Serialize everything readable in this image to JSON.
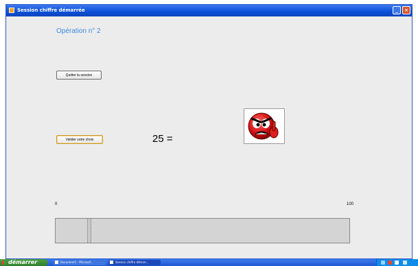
{
  "window": {
    "title": "Session chiffre démarrée",
    "minimize_glyph": "_",
    "close_glyph": "×"
  },
  "main": {
    "operation_title": "Opération n° 2",
    "quit_button_label": "Quitter la session",
    "validate_button_label": "Valider votre choix",
    "equation": "25 =",
    "emoticon": "angry-face-icon"
  },
  "slider": {
    "min_label": "0",
    "max_label": "100",
    "value_fraction": 0.11
  },
  "taskbar": {
    "start_label": "démarrer",
    "items": [
      {
        "label": "Document1 - Microsof..."
      },
      {
        "label": "Session chiffre démarr..."
      }
    ]
  },
  "colors": {
    "title_bar": "#0b4fd6",
    "operation_title": "#3d8be0",
    "background": "#ececec"
  }
}
